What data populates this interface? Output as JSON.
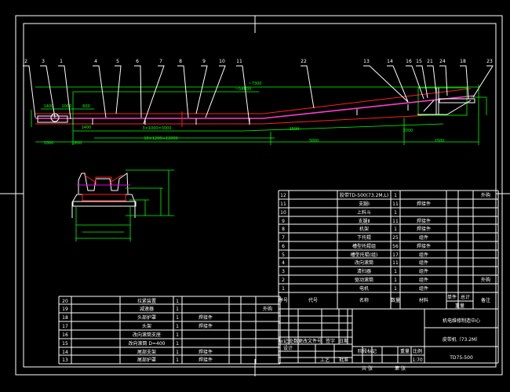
{
  "colors": {
    "background": "#000000",
    "frame": "#ffffff",
    "dimension": "#00ff00",
    "idler": "#ff2020",
    "belt": "#ff3cc8"
  },
  "callouts_left": [
    "2",
    "3",
    "1",
    "4",
    "5",
    "6",
    "7",
    "8",
    "9",
    "10",
    "11"
  ],
  "callouts_right": [
    "22",
    "13",
    "14",
    "16",
    "15",
    "21",
    "24",
    "18",
    "23"
  ],
  "dimensions": [
    "~7300",
    "~54800",
    "1400",
    "1000",
    "600",
    "1400",
    "3×1000=3000",
    "10×1200=12000",
    "1000",
    "1800",
    "1500",
    "3000",
    "1500",
    "2000"
  ],
  "parts_list": {
    "rows": [
      {
        "no": "12",
        "code": "",
        "name": "胶带TD-500(73.2M,L)",
        "qty": "1",
        "material": "",
        "note": "外购"
      },
      {
        "no": "11",
        "code": "",
        "name": "支腿Ⅰ",
        "qty": "11",
        "material": "焊接件",
        "note": ""
      },
      {
        "no": "10",
        "code": "",
        "name": "上料斗",
        "qty": "1",
        "material": "",
        "note": ""
      },
      {
        "no": "9",
        "code": "",
        "name": "支腿Ⅱ",
        "qty": "11",
        "material": "焊接件",
        "note": ""
      },
      {
        "no": "8",
        "code": "",
        "name": "机架",
        "qty": "1",
        "material": "焊接件",
        "note": ""
      },
      {
        "no": "7",
        "code": "",
        "name": "下托辊",
        "qty": "25",
        "material": "组件",
        "note": ""
      },
      {
        "no": "6",
        "code": "",
        "name": "槽型托辊组",
        "qty": "56",
        "material": "焊接件",
        "note": ""
      },
      {
        "no": "5",
        "code": "",
        "name": "槽型托辊(组)",
        "qty": "17",
        "material": "组件",
        "note": ""
      },
      {
        "no": "4",
        "code": "",
        "name": "改向滚筒",
        "qty": "11",
        "material": "组件",
        "note": ""
      },
      {
        "no": "3",
        "code": "",
        "name": "清扫器",
        "qty": "1",
        "material": "组件",
        "note": ""
      },
      {
        "no": "2",
        "code": "",
        "name": "驱动滚筒",
        "qty": "1",
        "material": "组件",
        "note": "外购"
      },
      {
        "no": "1",
        "code": "",
        "name": "电机",
        "qty": "1",
        "material": "组件",
        "note": ""
      }
    ],
    "header": {
      "no": "序号",
      "code": "代号",
      "name": "名称",
      "qty": "数量",
      "material": "材料",
      "unit": "单件",
      "total": "总计",
      "weight": "重量",
      "note": "备注"
    }
  },
  "parts_list_lower": [
    {
      "no": "20",
      "name": "拉紧装置",
      "qty": "1",
      "material": "",
      "note": ""
    },
    {
      "no": "19",
      "name": "减速器",
      "qty": "1",
      "material": "",
      "note": "外购"
    },
    {
      "no": "18",
      "name": "头部护罩",
      "qty": "1",
      "material": "焊接件",
      "note": ""
    },
    {
      "no": "17",
      "name": "头架",
      "qty": "1",
      "material": "焊接件",
      "note": ""
    },
    {
      "no": "16",
      "name": "改向滚筒支座",
      "qty": "1",
      "material": "",
      "note": ""
    },
    {
      "no": "15",
      "name": "改向滚筒 D=400",
      "qty": "1",
      "material": "",
      "note": ""
    },
    {
      "no": "14",
      "name": "尾部支架",
      "qty": "1",
      "material": "焊接件",
      "note": ""
    },
    {
      "no": "13",
      "name": "尾部护罩",
      "qty": "1",
      "material": "焊接件",
      "note": ""
    }
  ],
  "title_block": {
    "company": "机电维修制造中心",
    "drawing_name": "皮带机（73.2M）",
    "drawing_no": "TD75-500",
    "labels": {
      "mark": "标记",
      "count": "处数",
      "change_doc": "更改文件号",
      "sign": "签字",
      "date": "日期",
      "design": "设计",
      "stage": "阶段标记",
      "weight": "重量",
      "scale": "比例",
      "scale_value": "1:70",
      "sheets": "共 张",
      "sheet": "第 张",
      "process": "工艺",
      "approve": "批准"
    }
  }
}
